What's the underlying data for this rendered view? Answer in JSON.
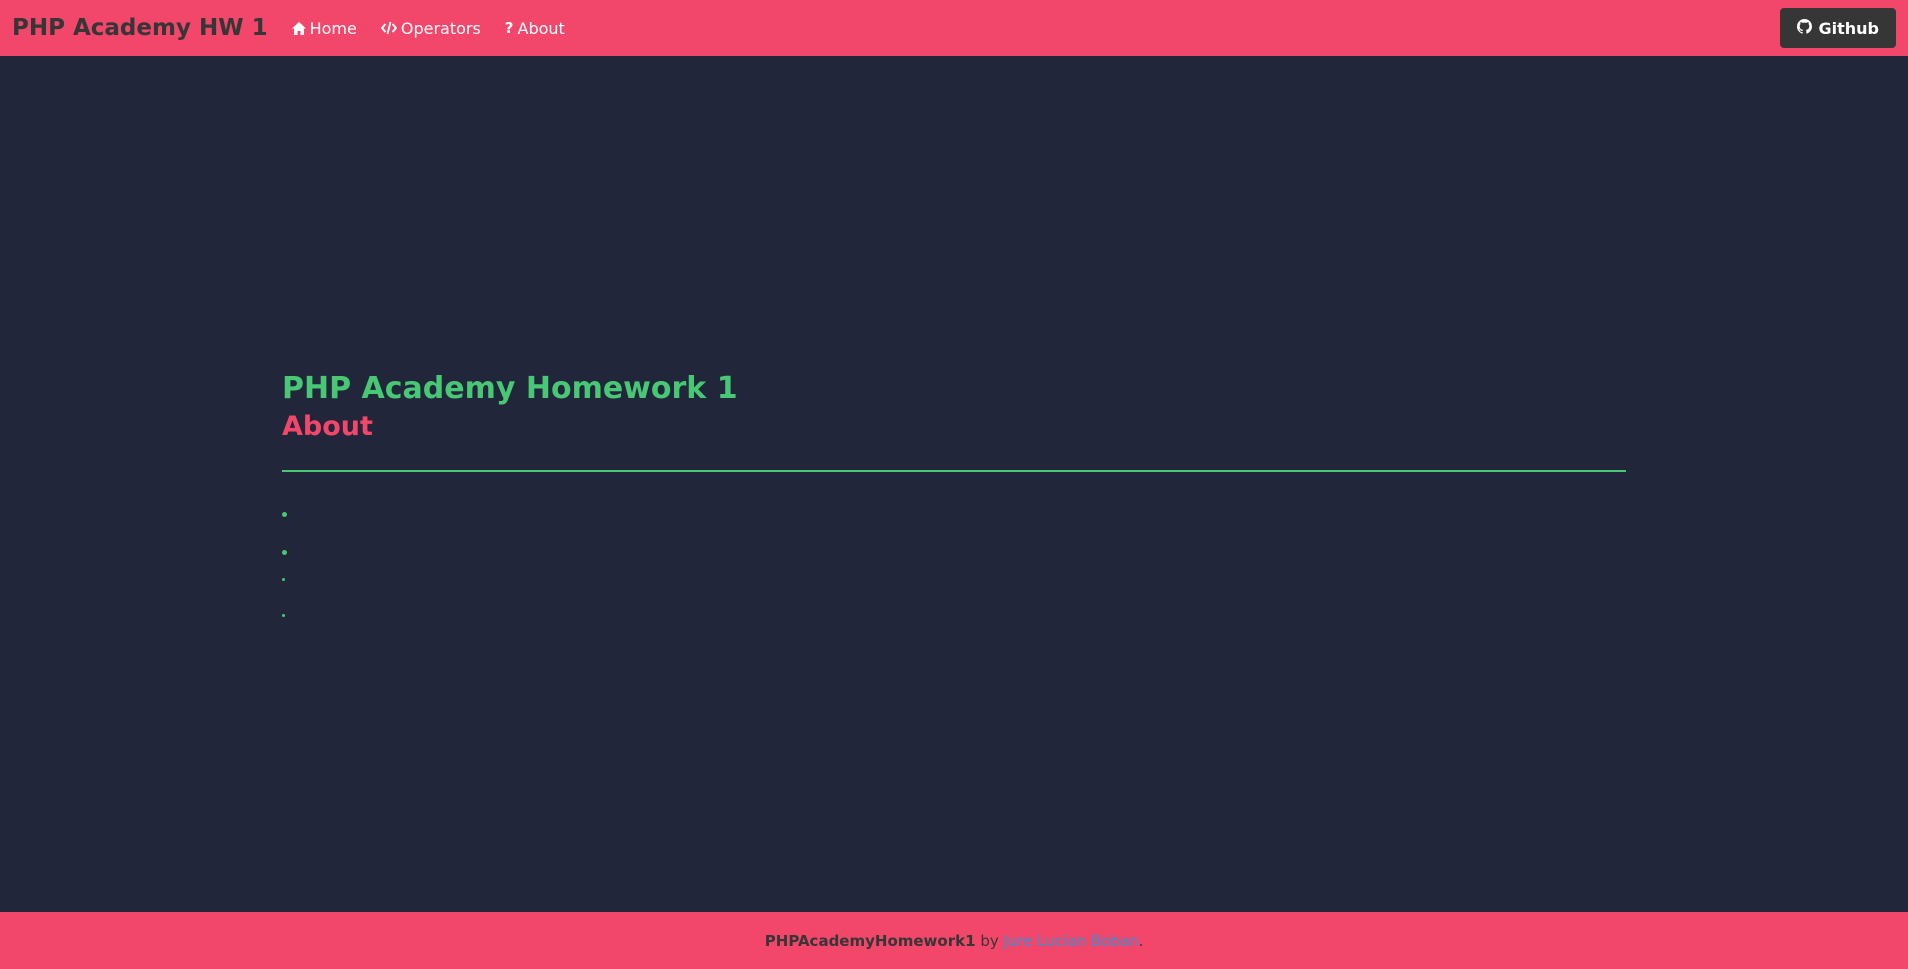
{
  "navbar": {
    "brand": "PHP Academy HW 1",
    "items": [
      {
        "label": "Home",
        "icon": "home-icon"
      },
      {
        "label": "Operators",
        "icon": "code-icon"
      },
      {
        "label": "About",
        "icon": "question-icon"
      }
    ],
    "github_label": "Github"
  },
  "main": {
    "title": "PHP Academy Homework 1",
    "subtitle": "About"
  },
  "footer": {
    "project": "PHPAcademyHomework1",
    "by": "by",
    "author": "Jure Lucian Boban",
    "suffix": "."
  },
  "colors": {
    "primary": "#f2466b",
    "accent": "#48c774",
    "background": "#21263a",
    "dark": "#363636",
    "link": "#3e8ed0"
  }
}
